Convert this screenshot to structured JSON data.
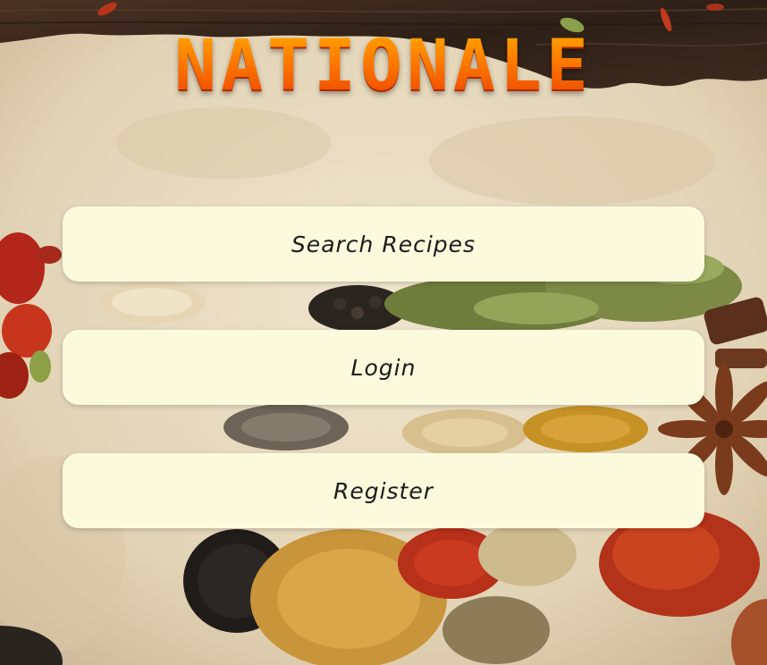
{
  "brand": {
    "title": "NATIONALE"
  },
  "menu": {
    "search_label": "Search Recipes",
    "login_label": "Login",
    "register_label": "Register"
  },
  "colors": {
    "button_bg": "#fbfadc",
    "brand_top": "#ffb000",
    "brand_bottom": "#e53a00",
    "paper": "#e8dcc4",
    "wood": "#3b2a1e"
  }
}
